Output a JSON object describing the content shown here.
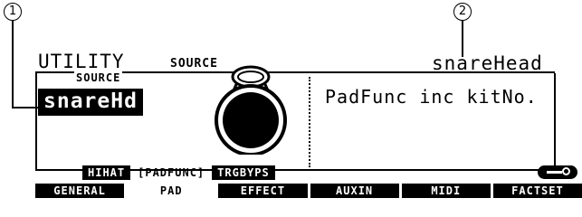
{
  "callouts": [
    "1",
    "2"
  ],
  "header": {
    "title": "UTILITY",
    "param": "SOURCE",
    "value": "snareHead"
  },
  "source": {
    "label": "SOURCE",
    "value": "snareHd"
  },
  "function_text": "PadFunc inc kitNo.",
  "sub_tabs": [
    "HIHAT",
    "[PADFUNC]",
    "TRGBYPS"
  ],
  "main_tabs": [
    "GENERAL",
    "PAD",
    "EFFECT",
    "AUXIN",
    "MIDI",
    "FACTSET"
  ],
  "active_tab": "PAD",
  "icons": {
    "pad": "drum-pad-icon",
    "key": "key-lock-icon"
  }
}
